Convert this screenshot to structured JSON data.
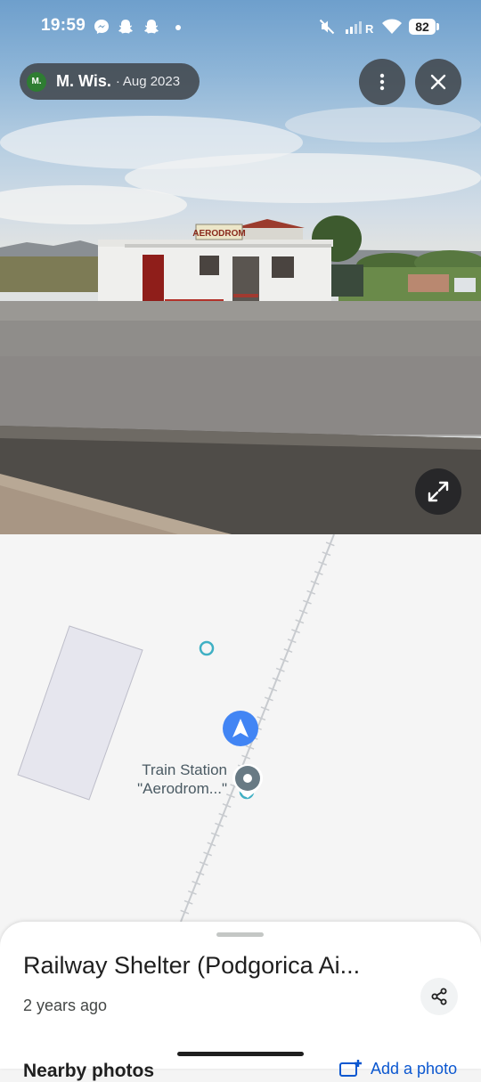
{
  "status_bar": {
    "time": "19:59",
    "battery": "82",
    "left_icons": [
      "messenger-icon",
      "snapchat-icon",
      "snapchat-icon"
    ],
    "right_icons": [
      "mute-icon",
      "signal-icon",
      "wifi-icon",
      "battery-icon"
    ]
  },
  "photo": {
    "author_initial": "M.",
    "author_name": "M. Wis.",
    "separator": "·",
    "date": "Aug 2023",
    "sign_text": "AERODROM",
    "avatar_color": "#2e7d32"
  },
  "map": {
    "pin_label": "Train Station \"Aerodrom...\"",
    "accent": "#4285f4",
    "pin_color": "#5f6c73",
    "marker_color": "#4db6c7"
  },
  "sheet": {
    "title": "Railway Shelter (Podgorica Ai...",
    "subtitle": "2 years ago",
    "next_section": "Nearby photos",
    "add_photo_label": "Add a photo"
  }
}
